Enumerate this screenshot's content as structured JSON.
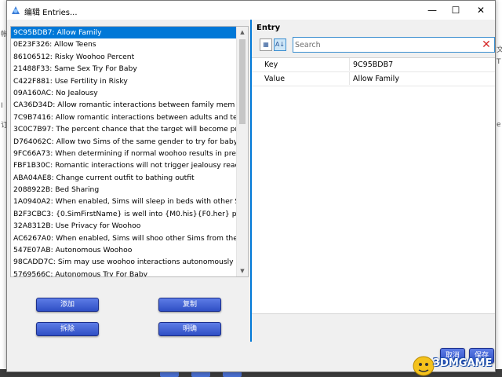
{
  "window": {
    "title": "编辑 Entries..."
  },
  "list": {
    "items": [
      "9C95BDB7: Allow Family",
      "0E23F326: Allow Teens",
      "86106512: Risky Woohoo Percent",
      "21488F33: Same Sex Try For Baby",
      "C422F881: Use Fertility in Risky",
      "09A160AC: No Jealousy",
      "CA36D34D: Allow romantic interactions between family mem",
      "7C9B7416: Allow romantic interactions between adults and te",
      "3C0C7B97: The percent chance that the target will become pr",
      "D764062C: Allow two Sims of the same gender to try for baby",
      "9FC66A73: When determining if normal woohoo results in pre",
      "FBF1B30C: Romantic interactions will not trigger jealousy reac",
      "ABA04AE8: Change current outfit to bathing outfit",
      "2088922B: Bed Sharing",
      "1A0940A2: When enabled, Sims will sleep in beds with other S",
      "B2F3CBC3: {0.SimFirstName} is well into {M0.his}{F0.her} pregn",
      "32A8312B: Use Privacy for Woohoo",
      "AC6267A0: When enabled, Sims will shoo other Sims from the",
      "547E07AB: Autonomous Woohoo",
      "98CADD7C: Sim may use woohoo interactions autonomously",
      "5769566C: Autonomous Try For Baby"
    ]
  },
  "buttons": {
    "add": "添加",
    "copy": "复制",
    "delete": "拆除",
    "confirm": "明确",
    "cancel": "取消",
    "save": "保存"
  },
  "entry": {
    "title": "Entry",
    "search_placeholder": "Search",
    "rows": [
      {
        "key": "Key",
        "value": "9C95BDB7"
      },
      {
        "key": "Value",
        "value": "Allow Family"
      }
    ]
  },
  "watermark": {
    "text": "3DMGAME"
  },
  "colors": {
    "selection": "#0078d7",
    "button": "#3a5bd6",
    "clear": "#d62828"
  }
}
